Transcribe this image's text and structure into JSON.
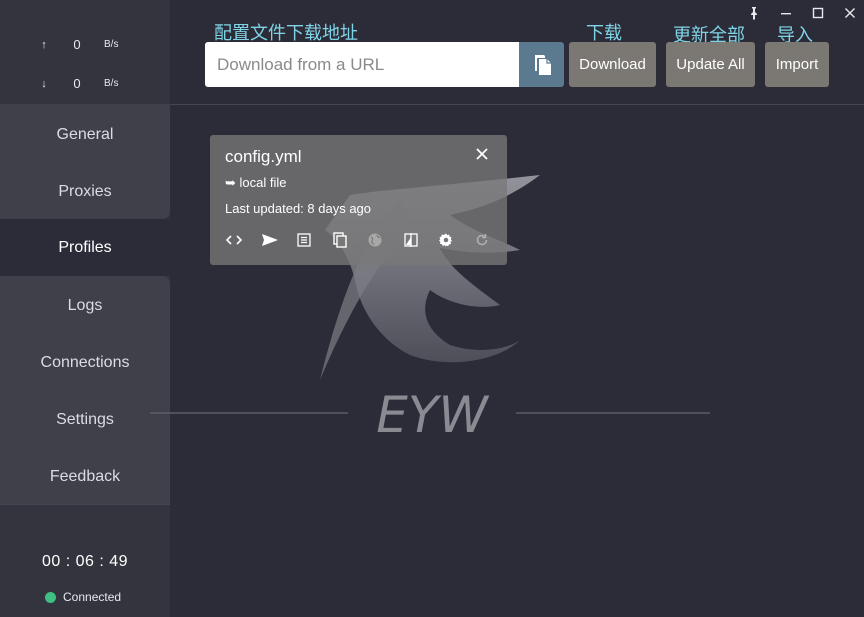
{
  "window": {
    "controls": {
      "pin_icon": "pin-icon",
      "minimize_icon": "minimize-icon",
      "maximize_icon": "maximize-icon",
      "close_icon": "close-icon"
    }
  },
  "speed": {
    "up": {
      "arrow": "↑",
      "value": "0",
      "unit": "B/s"
    },
    "down": {
      "arrow": "↓",
      "value": "0",
      "unit": "B/s"
    }
  },
  "sidebar": {
    "items": [
      {
        "label": "General",
        "active": false
      },
      {
        "label": "Proxies",
        "active": false
      },
      {
        "label": "Profiles",
        "active": true
      },
      {
        "label": "Logs",
        "active": false
      },
      {
        "label": "Connections",
        "active": false
      },
      {
        "label": "Settings",
        "active": false
      },
      {
        "label": "Feedback",
        "active": false
      }
    ],
    "timer": "00 : 06 : 49",
    "status": "Connected"
  },
  "annotations": {
    "config_download": "配置文件下载地址",
    "download": "下载",
    "update_all": "更新全部",
    "import": "导入"
  },
  "toolbar": {
    "url_placeholder": "Download from a URL",
    "url_value": "",
    "paste_icon": "paste-icon",
    "download_label": "Download",
    "update_all_label": "Update All",
    "import_label": "Import"
  },
  "logo": {
    "text": "EYW"
  },
  "profile_card": {
    "name": "config.yml",
    "type": "➥ local file",
    "updated": "Last updated: 8 days ago",
    "actions": [
      "code-icon",
      "send-icon",
      "list-icon",
      "copy-icon",
      "globe-icon",
      "compare-icon",
      "gear-icon",
      "refresh-icon"
    ]
  },
  "colors": {
    "accent": "#5b7a90",
    "button": "#7b7772",
    "annotation": "#7fd3e6",
    "connected": "#3fbf83"
  }
}
